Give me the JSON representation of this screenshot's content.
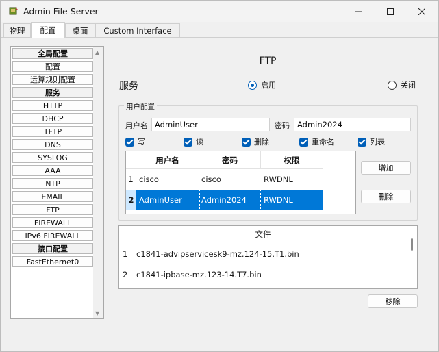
{
  "window": {
    "title": "Admin File Server",
    "controls": {
      "minimize": "—",
      "maximize": "☐",
      "close": "✕"
    }
  },
  "tabs": [
    {
      "label": "物理"
    },
    {
      "label": "配置",
      "active": true
    },
    {
      "label": "桌面"
    },
    {
      "label": "Custom Interface"
    }
  ],
  "sidebar": {
    "items": [
      {
        "label": "全局配置",
        "header": true
      },
      {
        "label": "配置"
      },
      {
        "label": "运算规则配置"
      },
      {
        "label": "服务",
        "header": true
      },
      {
        "label": "HTTP"
      },
      {
        "label": "DHCP"
      },
      {
        "label": "TFTP"
      },
      {
        "label": "DNS"
      },
      {
        "label": "SYSLOG"
      },
      {
        "label": "AAA"
      },
      {
        "label": "NTP"
      },
      {
        "label": "EMAIL"
      },
      {
        "label": "FTP"
      },
      {
        "label": "FIREWALL"
      },
      {
        "label": "IPv6 FIREWALL"
      },
      {
        "label": "接口配置",
        "header": true
      },
      {
        "label": "FastEthernet0"
      }
    ]
  },
  "ftp": {
    "title": "FTP",
    "service_label": "服务",
    "on_label": "启用",
    "off_label": "关闭",
    "service_on": true,
    "user_config": {
      "group_label": "用户配置",
      "username_label": "用户名",
      "username_value": "AdminUser",
      "password_label": "密码",
      "password_value": "Admin2024",
      "permissions": [
        {
          "label": "写",
          "checked": true
        },
        {
          "label": "读",
          "checked": true
        },
        {
          "label": "删除",
          "checked": true
        },
        {
          "label": "重命名",
          "checked": true
        },
        {
          "label": "列表",
          "checked": true
        }
      ],
      "table": {
        "columns": [
          "用户名",
          "密码",
          "权限"
        ],
        "rows": [
          {
            "num": "1",
            "username": "cisco",
            "password": "cisco",
            "permission": "RWDNL"
          },
          {
            "num": "2",
            "username": "AdminUser",
            "password": "Admin2024",
            "permission": "RWDNL",
            "selected": true
          }
        ]
      },
      "add_label": "增加",
      "delete_label": "删除"
    },
    "files": {
      "header": "文件",
      "rows": [
        {
          "num": "1",
          "name": "c1841-advipservicesk9-mz.124-15.T1.bin"
        },
        {
          "num": "2",
          "name": "c1841-ipbase-mz.123-14.T7.bin"
        }
      ]
    },
    "remove_label": "移除"
  },
  "colors": {
    "accent": "#005fb8",
    "selection": "#0078d7"
  }
}
